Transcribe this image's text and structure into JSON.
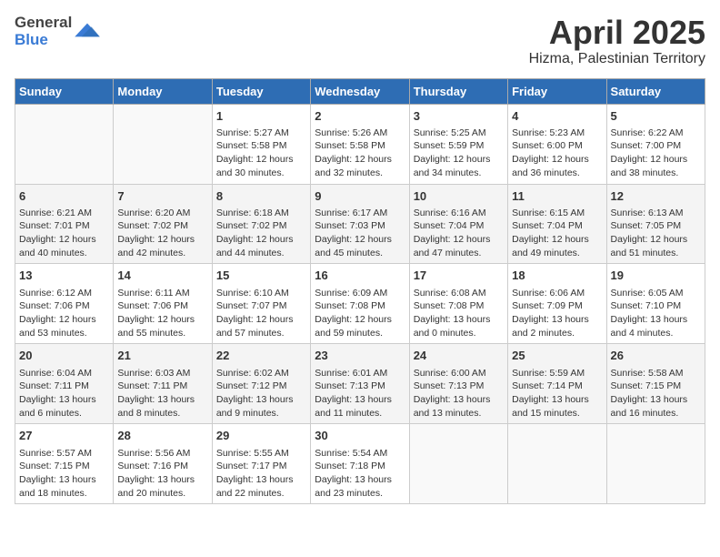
{
  "header": {
    "logo_general": "General",
    "logo_blue": "Blue",
    "title": "April 2025",
    "subtitle": "Hizma, Palestinian Territory"
  },
  "days_of_week": [
    "Sunday",
    "Monday",
    "Tuesday",
    "Wednesday",
    "Thursday",
    "Friday",
    "Saturday"
  ],
  "weeks": [
    [
      {
        "day": "",
        "sunrise": "",
        "sunset": "",
        "daylight": ""
      },
      {
        "day": "",
        "sunrise": "",
        "sunset": "",
        "daylight": ""
      },
      {
        "day": "1",
        "sunrise": "Sunrise: 5:27 AM",
        "sunset": "Sunset: 5:58 PM",
        "daylight": "Daylight: 12 hours and 30 minutes."
      },
      {
        "day": "2",
        "sunrise": "Sunrise: 5:26 AM",
        "sunset": "Sunset: 5:58 PM",
        "daylight": "Daylight: 12 hours and 32 minutes."
      },
      {
        "day": "3",
        "sunrise": "Sunrise: 5:25 AM",
        "sunset": "Sunset: 5:59 PM",
        "daylight": "Daylight: 12 hours and 34 minutes."
      },
      {
        "day": "4",
        "sunrise": "Sunrise: 5:23 AM",
        "sunset": "Sunset: 6:00 PM",
        "daylight": "Daylight: 12 hours and 36 minutes."
      },
      {
        "day": "5",
        "sunrise": "Sunrise: 6:22 AM",
        "sunset": "Sunset: 7:00 PM",
        "daylight": "Daylight: 12 hours and 38 minutes."
      }
    ],
    [
      {
        "day": "6",
        "sunrise": "Sunrise: 6:21 AM",
        "sunset": "Sunset: 7:01 PM",
        "daylight": "Daylight: 12 hours and 40 minutes."
      },
      {
        "day": "7",
        "sunrise": "Sunrise: 6:20 AM",
        "sunset": "Sunset: 7:02 PM",
        "daylight": "Daylight: 12 hours and 42 minutes."
      },
      {
        "day": "8",
        "sunrise": "Sunrise: 6:18 AM",
        "sunset": "Sunset: 7:02 PM",
        "daylight": "Daylight: 12 hours and 44 minutes."
      },
      {
        "day": "9",
        "sunrise": "Sunrise: 6:17 AM",
        "sunset": "Sunset: 7:03 PM",
        "daylight": "Daylight: 12 hours and 45 minutes."
      },
      {
        "day": "10",
        "sunrise": "Sunrise: 6:16 AM",
        "sunset": "Sunset: 7:04 PM",
        "daylight": "Daylight: 12 hours and 47 minutes."
      },
      {
        "day": "11",
        "sunrise": "Sunrise: 6:15 AM",
        "sunset": "Sunset: 7:04 PM",
        "daylight": "Daylight: 12 hours and 49 minutes."
      },
      {
        "day": "12",
        "sunrise": "Sunrise: 6:13 AM",
        "sunset": "Sunset: 7:05 PM",
        "daylight": "Daylight: 12 hours and 51 minutes."
      }
    ],
    [
      {
        "day": "13",
        "sunrise": "Sunrise: 6:12 AM",
        "sunset": "Sunset: 7:06 PM",
        "daylight": "Daylight: 12 hours and 53 minutes."
      },
      {
        "day": "14",
        "sunrise": "Sunrise: 6:11 AM",
        "sunset": "Sunset: 7:06 PM",
        "daylight": "Daylight: 12 hours and 55 minutes."
      },
      {
        "day": "15",
        "sunrise": "Sunrise: 6:10 AM",
        "sunset": "Sunset: 7:07 PM",
        "daylight": "Daylight: 12 hours and 57 minutes."
      },
      {
        "day": "16",
        "sunrise": "Sunrise: 6:09 AM",
        "sunset": "Sunset: 7:08 PM",
        "daylight": "Daylight: 12 hours and 59 minutes."
      },
      {
        "day": "17",
        "sunrise": "Sunrise: 6:08 AM",
        "sunset": "Sunset: 7:08 PM",
        "daylight": "Daylight: 13 hours and 0 minutes."
      },
      {
        "day": "18",
        "sunrise": "Sunrise: 6:06 AM",
        "sunset": "Sunset: 7:09 PM",
        "daylight": "Daylight: 13 hours and 2 minutes."
      },
      {
        "day": "19",
        "sunrise": "Sunrise: 6:05 AM",
        "sunset": "Sunset: 7:10 PM",
        "daylight": "Daylight: 13 hours and 4 minutes."
      }
    ],
    [
      {
        "day": "20",
        "sunrise": "Sunrise: 6:04 AM",
        "sunset": "Sunset: 7:11 PM",
        "daylight": "Daylight: 13 hours and 6 minutes."
      },
      {
        "day": "21",
        "sunrise": "Sunrise: 6:03 AM",
        "sunset": "Sunset: 7:11 PM",
        "daylight": "Daylight: 13 hours and 8 minutes."
      },
      {
        "day": "22",
        "sunrise": "Sunrise: 6:02 AM",
        "sunset": "Sunset: 7:12 PM",
        "daylight": "Daylight: 13 hours and 9 minutes."
      },
      {
        "day": "23",
        "sunrise": "Sunrise: 6:01 AM",
        "sunset": "Sunset: 7:13 PM",
        "daylight": "Daylight: 13 hours and 11 minutes."
      },
      {
        "day": "24",
        "sunrise": "Sunrise: 6:00 AM",
        "sunset": "Sunset: 7:13 PM",
        "daylight": "Daylight: 13 hours and 13 minutes."
      },
      {
        "day": "25",
        "sunrise": "Sunrise: 5:59 AM",
        "sunset": "Sunset: 7:14 PM",
        "daylight": "Daylight: 13 hours and 15 minutes."
      },
      {
        "day": "26",
        "sunrise": "Sunrise: 5:58 AM",
        "sunset": "Sunset: 7:15 PM",
        "daylight": "Daylight: 13 hours and 16 minutes."
      }
    ],
    [
      {
        "day": "27",
        "sunrise": "Sunrise: 5:57 AM",
        "sunset": "Sunset: 7:15 PM",
        "daylight": "Daylight: 13 hours and 18 minutes."
      },
      {
        "day": "28",
        "sunrise": "Sunrise: 5:56 AM",
        "sunset": "Sunset: 7:16 PM",
        "daylight": "Daylight: 13 hours and 20 minutes."
      },
      {
        "day": "29",
        "sunrise": "Sunrise: 5:55 AM",
        "sunset": "Sunset: 7:17 PM",
        "daylight": "Daylight: 13 hours and 22 minutes."
      },
      {
        "day": "30",
        "sunrise": "Sunrise: 5:54 AM",
        "sunset": "Sunset: 7:18 PM",
        "daylight": "Daylight: 13 hours and 23 minutes."
      },
      {
        "day": "",
        "sunrise": "",
        "sunset": "",
        "daylight": ""
      },
      {
        "day": "",
        "sunrise": "",
        "sunset": "",
        "daylight": ""
      },
      {
        "day": "",
        "sunrise": "",
        "sunset": "",
        "daylight": ""
      }
    ]
  ]
}
